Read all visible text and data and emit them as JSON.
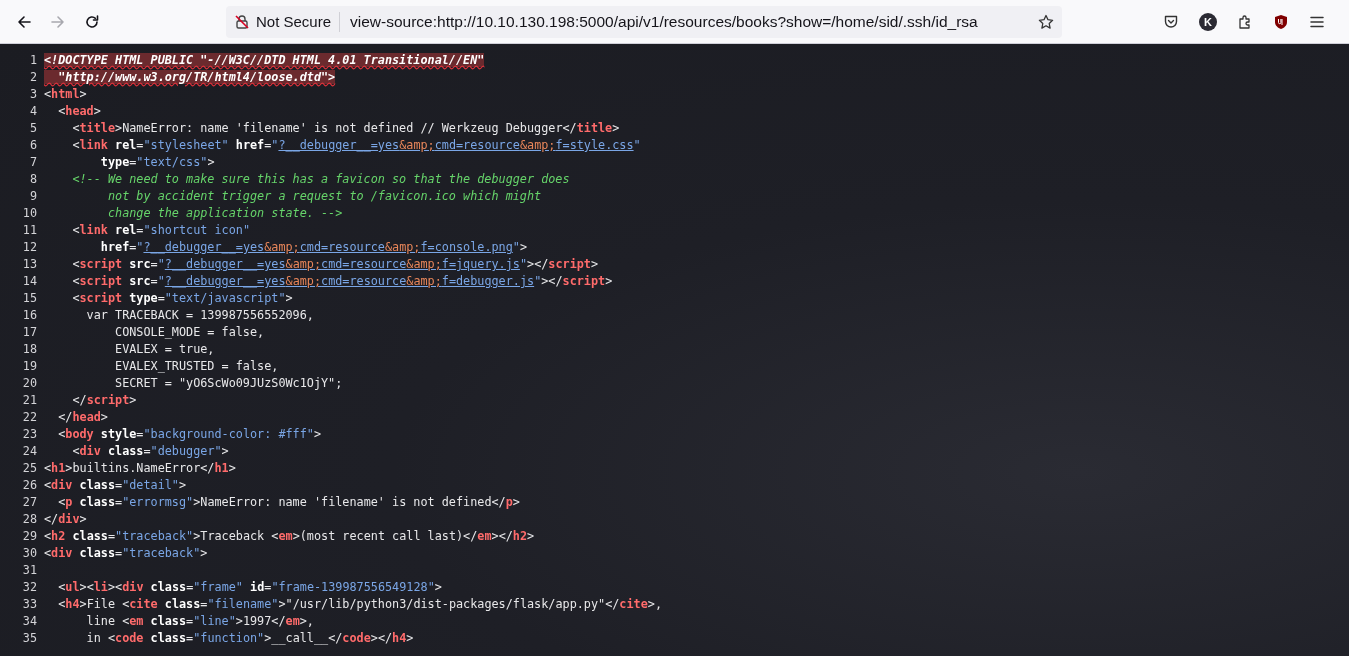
{
  "toolbar": {
    "nav_buttons": [
      {
        "kind": "back",
        "disabled": false
      },
      {
        "kind": "forward",
        "disabled": true
      },
      {
        "kind": "reload",
        "disabled": false
      }
    ],
    "address_bar": {
      "security_label": "Not Secure",
      "url": "view-source:http://10.10.130.198:5000/api/v1/resources/books?show=/home/sid/.ssh/id_rsa"
    },
    "right_buttons": [
      {
        "kind": "pocket"
      },
      {
        "kind": "account",
        "letter": "K"
      },
      {
        "kind": "extensions"
      },
      {
        "kind": "ublock"
      },
      {
        "kind": "menu"
      }
    ]
  },
  "source_lines": [
    {
      "number": "1",
      "tokens": [
        {
          "kind": "doctype",
          "text": "<!DOCTYPE HTML PUBLIC \"-//W3C//DTD HTML 4.01 Transitional//EN\""
        }
      ]
    },
    {
      "number": "2",
      "tokens": [
        {
          "kind": "doctype",
          "text": "  \"http://www.w3.org/TR/html4/loose.dtd\">"
        }
      ]
    },
    {
      "number": "3",
      "tokens": [
        {
          "kind": "text",
          "text": "<"
        },
        {
          "kind": "tag",
          "text": "html"
        },
        {
          "kind": "text",
          "text": ">"
        }
      ]
    },
    {
      "number": "4",
      "tokens": [
        {
          "kind": "text",
          "text": "  <"
        },
        {
          "kind": "tag",
          "text": "head"
        },
        {
          "kind": "text",
          "text": ">"
        }
      ]
    },
    {
      "number": "5",
      "tokens": [
        {
          "kind": "text",
          "text": "    <"
        },
        {
          "kind": "tag",
          "text": "title"
        },
        {
          "kind": "text",
          "text": ">NameError: name 'filename' is not defined // Werkzeug Debugger</"
        },
        {
          "kind": "tag",
          "text": "title"
        },
        {
          "kind": "text",
          "text": ">"
        }
      ]
    },
    {
      "number": "6",
      "tokens": [
        {
          "kind": "text",
          "text": "    <"
        },
        {
          "kind": "tag",
          "text": "link"
        },
        {
          "kind": "attr",
          "text": " rel"
        },
        {
          "kind": "text",
          "text": "="
        },
        {
          "kind": "value",
          "text": "\"stylesheet\""
        },
        {
          "kind": "attr",
          "text": " href"
        },
        {
          "kind": "text",
          "text": "="
        },
        {
          "kind": "value",
          "text": "\""
        },
        {
          "kind": "link",
          "parts": [
            {
              "kind": "text",
              "text": "?__debugger__=yes"
            },
            {
              "kind": "entity",
              "text": "&amp;"
            },
            {
              "kind": "text",
              "text": "cmd=resource"
            },
            {
              "kind": "entity",
              "text": "&amp;"
            },
            {
              "kind": "text",
              "text": "f=style.css"
            }
          ]
        },
        {
          "kind": "value",
          "text": "\""
        }
      ]
    },
    {
      "number": "7",
      "tokens": [
        {
          "kind": "attr",
          "text": "        type"
        },
        {
          "kind": "text",
          "text": "="
        },
        {
          "kind": "value",
          "text": "\"text/css\""
        },
        {
          "kind": "text",
          "text": ">"
        }
      ]
    },
    {
      "number": "8",
      "tokens": [
        {
          "kind": "comment",
          "text": "    <!-- We need to make sure this has a favicon so that the debugger does"
        }
      ]
    },
    {
      "number": "9",
      "tokens": [
        {
          "kind": "comment",
          "text": "         not by accident trigger a request to /favicon.ico which might"
        }
      ]
    },
    {
      "number": "10",
      "tokens": [
        {
          "kind": "comment",
          "text": "         change the application state. -->"
        }
      ]
    },
    {
      "number": "11",
      "tokens": [
        {
          "kind": "text",
          "text": "    <"
        },
        {
          "kind": "tag",
          "text": "link"
        },
        {
          "kind": "attr",
          "text": " rel"
        },
        {
          "kind": "text",
          "text": "="
        },
        {
          "kind": "value",
          "text": "\"shortcut icon\""
        }
      ]
    },
    {
      "number": "12",
      "tokens": [
        {
          "kind": "attr",
          "text": "        href"
        },
        {
          "kind": "text",
          "text": "="
        },
        {
          "kind": "value",
          "text": "\""
        },
        {
          "kind": "link",
          "parts": [
            {
              "kind": "text",
              "text": "?__debugger__=yes"
            },
            {
              "kind": "entity",
              "text": "&amp;"
            },
            {
              "kind": "text",
              "text": "cmd=resource"
            },
            {
              "kind": "entity",
              "text": "&amp;"
            },
            {
              "kind": "text",
              "text": "f=console.png"
            }
          ]
        },
        {
          "kind": "value",
          "text": "\""
        },
        {
          "kind": "text",
          "text": ">"
        }
      ]
    },
    {
      "number": "13",
      "tokens": [
        {
          "kind": "text",
          "text": "    <"
        },
        {
          "kind": "tag",
          "text": "script"
        },
        {
          "kind": "attr",
          "text": " src"
        },
        {
          "kind": "text",
          "text": "="
        },
        {
          "kind": "value",
          "text": "\""
        },
        {
          "kind": "link",
          "parts": [
            {
              "kind": "text",
              "text": "?__debugger__=yes"
            },
            {
              "kind": "entity",
              "text": "&amp;"
            },
            {
              "kind": "text",
              "text": "cmd=resource"
            },
            {
              "kind": "entity",
              "text": "&amp;"
            },
            {
              "kind": "text",
              "text": "f=jquery.js"
            }
          ]
        },
        {
          "kind": "value",
          "text": "\""
        },
        {
          "kind": "text",
          "text": "></"
        },
        {
          "kind": "tag",
          "text": "script"
        },
        {
          "kind": "text",
          "text": ">"
        }
      ]
    },
    {
      "number": "14",
      "tokens": [
        {
          "kind": "text",
          "text": "    <"
        },
        {
          "kind": "tag",
          "text": "script"
        },
        {
          "kind": "attr",
          "text": " src"
        },
        {
          "kind": "text",
          "text": "="
        },
        {
          "kind": "value",
          "text": "\""
        },
        {
          "kind": "link",
          "parts": [
            {
              "kind": "text",
              "text": "?__debugger__=yes"
            },
            {
              "kind": "entity",
              "text": "&amp;"
            },
            {
              "kind": "text",
              "text": "cmd=resource"
            },
            {
              "kind": "entity",
              "text": "&amp;"
            },
            {
              "kind": "text",
              "text": "f=debugger.js"
            }
          ]
        },
        {
          "kind": "value",
          "text": "\""
        },
        {
          "kind": "text",
          "text": "></"
        },
        {
          "kind": "tag",
          "text": "script"
        },
        {
          "kind": "text",
          "text": ">"
        }
      ]
    },
    {
      "number": "15",
      "tokens": [
        {
          "kind": "text",
          "text": "    <"
        },
        {
          "kind": "tag",
          "text": "script"
        },
        {
          "kind": "attr",
          "text": " type"
        },
        {
          "kind": "text",
          "text": "="
        },
        {
          "kind": "value",
          "text": "\"text/javascript\""
        },
        {
          "kind": "text",
          "text": ">"
        }
      ]
    },
    {
      "number": "16",
      "tokens": [
        {
          "kind": "text",
          "text": "      var TRACEBACK = 139987556552096,"
        }
      ]
    },
    {
      "number": "17",
      "tokens": [
        {
          "kind": "text",
          "text": "          CONSOLE_MODE = false,"
        }
      ]
    },
    {
      "number": "18",
      "tokens": [
        {
          "kind": "text",
          "text": "          EVALEX = true,"
        }
      ]
    },
    {
      "number": "19",
      "tokens": [
        {
          "kind": "text",
          "text": "          EVALEX_TRUSTED = false,"
        }
      ]
    },
    {
      "number": "20",
      "tokens": [
        {
          "kind": "text",
          "text": "          SECRET = \"yO6ScWo09JUzS0Wc1OjY\";"
        }
      ]
    },
    {
      "number": "21",
      "tokens": [
        {
          "kind": "text",
          "text": "    </"
        },
        {
          "kind": "tag",
          "text": "script"
        },
        {
          "kind": "text",
          "text": ">"
        }
      ]
    },
    {
      "number": "22",
      "tokens": [
        {
          "kind": "text",
          "text": "  </"
        },
        {
          "kind": "tag",
          "text": "head"
        },
        {
          "kind": "text",
          "text": ">"
        }
      ]
    },
    {
      "number": "23",
      "tokens": [
        {
          "kind": "text",
          "text": "  <"
        },
        {
          "kind": "tag",
          "text": "body"
        },
        {
          "kind": "attr",
          "text": " style"
        },
        {
          "kind": "text",
          "text": "="
        },
        {
          "kind": "value",
          "text": "\"background-color: #fff\""
        },
        {
          "kind": "text",
          "text": ">"
        }
      ]
    },
    {
      "number": "24",
      "tokens": [
        {
          "kind": "text",
          "text": "    <"
        },
        {
          "kind": "tag",
          "text": "div"
        },
        {
          "kind": "attr",
          "text": " class"
        },
        {
          "kind": "text",
          "text": "="
        },
        {
          "kind": "value",
          "text": "\"debugger\""
        },
        {
          "kind": "text",
          "text": ">"
        }
      ]
    },
    {
      "number": "25",
      "tokens": [
        {
          "kind": "text",
          "text": "<"
        },
        {
          "kind": "tag",
          "text": "h1"
        },
        {
          "kind": "text",
          "text": ">builtins.NameError</"
        },
        {
          "kind": "tag",
          "text": "h1"
        },
        {
          "kind": "text",
          "text": ">"
        }
      ]
    },
    {
      "number": "26",
      "tokens": [
        {
          "kind": "text",
          "text": "<"
        },
        {
          "kind": "tag",
          "text": "div"
        },
        {
          "kind": "attr",
          "text": " class"
        },
        {
          "kind": "text",
          "text": "="
        },
        {
          "kind": "value",
          "text": "\"detail\""
        },
        {
          "kind": "text",
          "text": ">"
        }
      ]
    },
    {
      "number": "27",
      "tokens": [
        {
          "kind": "text",
          "text": "  <"
        },
        {
          "kind": "tag",
          "text": "p"
        },
        {
          "kind": "attr",
          "text": " class"
        },
        {
          "kind": "text",
          "text": "="
        },
        {
          "kind": "value",
          "text": "\"errormsg\""
        },
        {
          "kind": "text",
          "text": ">NameError: name 'filename' is not defined</"
        },
        {
          "kind": "tag",
          "text": "p"
        },
        {
          "kind": "text",
          "text": ">"
        }
      ]
    },
    {
      "number": "28",
      "tokens": [
        {
          "kind": "text",
          "text": "</"
        },
        {
          "kind": "tag",
          "text": "div"
        },
        {
          "kind": "text",
          "text": ">"
        }
      ]
    },
    {
      "number": "29",
      "tokens": [
        {
          "kind": "text",
          "text": "<"
        },
        {
          "kind": "tag",
          "text": "h2"
        },
        {
          "kind": "attr",
          "text": " class"
        },
        {
          "kind": "text",
          "text": "="
        },
        {
          "kind": "value",
          "text": "\"traceback\""
        },
        {
          "kind": "text",
          "text": ">Traceback <"
        },
        {
          "kind": "tag",
          "text": "em"
        },
        {
          "kind": "text",
          "text": ">(most recent call last)</"
        },
        {
          "kind": "tag",
          "text": "em"
        },
        {
          "kind": "text",
          "text": "></"
        },
        {
          "kind": "tag",
          "text": "h2"
        },
        {
          "kind": "text",
          "text": ">"
        }
      ]
    },
    {
      "number": "30",
      "tokens": [
        {
          "kind": "text",
          "text": "<"
        },
        {
          "kind": "tag",
          "text": "div"
        },
        {
          "kind": "attr",
          "text": " class"
        },
        {
          "kind": "text",
          "text": "="
        },
        {
          "kind": "value",
          "text": "\"traceback\""
        },
        {
          "kind": "text",
          "text": ">"
        }
      ]
    },
    {
      "number": "31"
    },
    {
      "number": "32",
      "tokens": [
        {
          "kind": "text",
          "text": "  <"
        },
        {
          "kind": "tag",
          "text": "ul"
        },
        {
          "kind": "text",
          "text": "><"
        },
        {
          "kind": "tag",
          "text": "li"
        },
        {
          "kind": "text",
          "text": "><"
        },
        {
          "kind": "tag",
          "text": "div"
        },
        {
          "kind": "attr",
          "text": " class"
        },
        {
          "kind": "text",
          "text": "="
        },
        {
          "kind": "value",
          "text": "\"frame\""
        },
        {
          "kind": "attr",
          "text": " id"
        },
        {
          "kind": "text",
          "text": "="
        },
        {
          "kind": "value",
          "text": "\"frame-139987556549128\""
        },
        {
          "kind": "text",
          "text": ">"
        }
      ]
    },
    {
      "number": "33",
      "tokens": [
        {
          "kind": "text",
          "text": "  <"
        },
        {
          "kind": "tag",
          "text": "h4"
        },
        {
          "kind": "text",
          "text": ">File <"
        },
        {
          "kind": "tag",
          "text": "cite"
        },
        {
          "kind": "attr",
          "text": " class"
        },
        {
          "kind": "text",
          "text": "="
        },
        {
          "kind": "value",
          "text": "\"filename\""
        },
        {
          "kind": "text",
          "text": ">\"/usr/lib/python3/dist-packages/flask/app.py\"</"
        },
        {
          "kind": "tag",
          "text": "cite"
        },
        {
          "kind": "text",
          "text": ">,"
        }
      ]
    },
    {
      "number": "34",
      "tokens": [
        {
          "kind": "text",
          "text": "      line <"
        },
        {
          "kind": "tag",
          "text": "em"
        },
        {
          "kind": "attr",
          "text": " class"
        },
        {
          "kind": "text",
          "text": "="
        },
        {
          "kind": "value",
          "text": "\"line\""
        },
        {
          "kind": "text",
          "text": ">1997</"
        },
        {
          "kind": "tag",
          "text": "em"
        },
        {
          "kind": "text",
          "text": ">,"
        }
      ]
    },
    {
      "number": "35",
      "tokens": [
        {
          "kind": "text",
          "text": "      in <"
        },
        {
          "kind": "tag",
          "text": "code"
        },
        {
          "kind": "attr",
          "text": " class"
        },
        {
          "kind": "text",
          "text": "="
        },
        {
          "kind": "value",
          "text": "\"function\""
        },
        {
          "kind": "text",
          "text": ">__call__</"
        },
        {
          "kind": "tag",
          "text": "code"
        },
        {
          "kind": "text",
          "text": "></"
        },
        {
          "kind": "tag",
          "text": "h4"
        },
        {
          "kind": "text",
          "text": ">"
        }
      ]
    }
  ]
}
